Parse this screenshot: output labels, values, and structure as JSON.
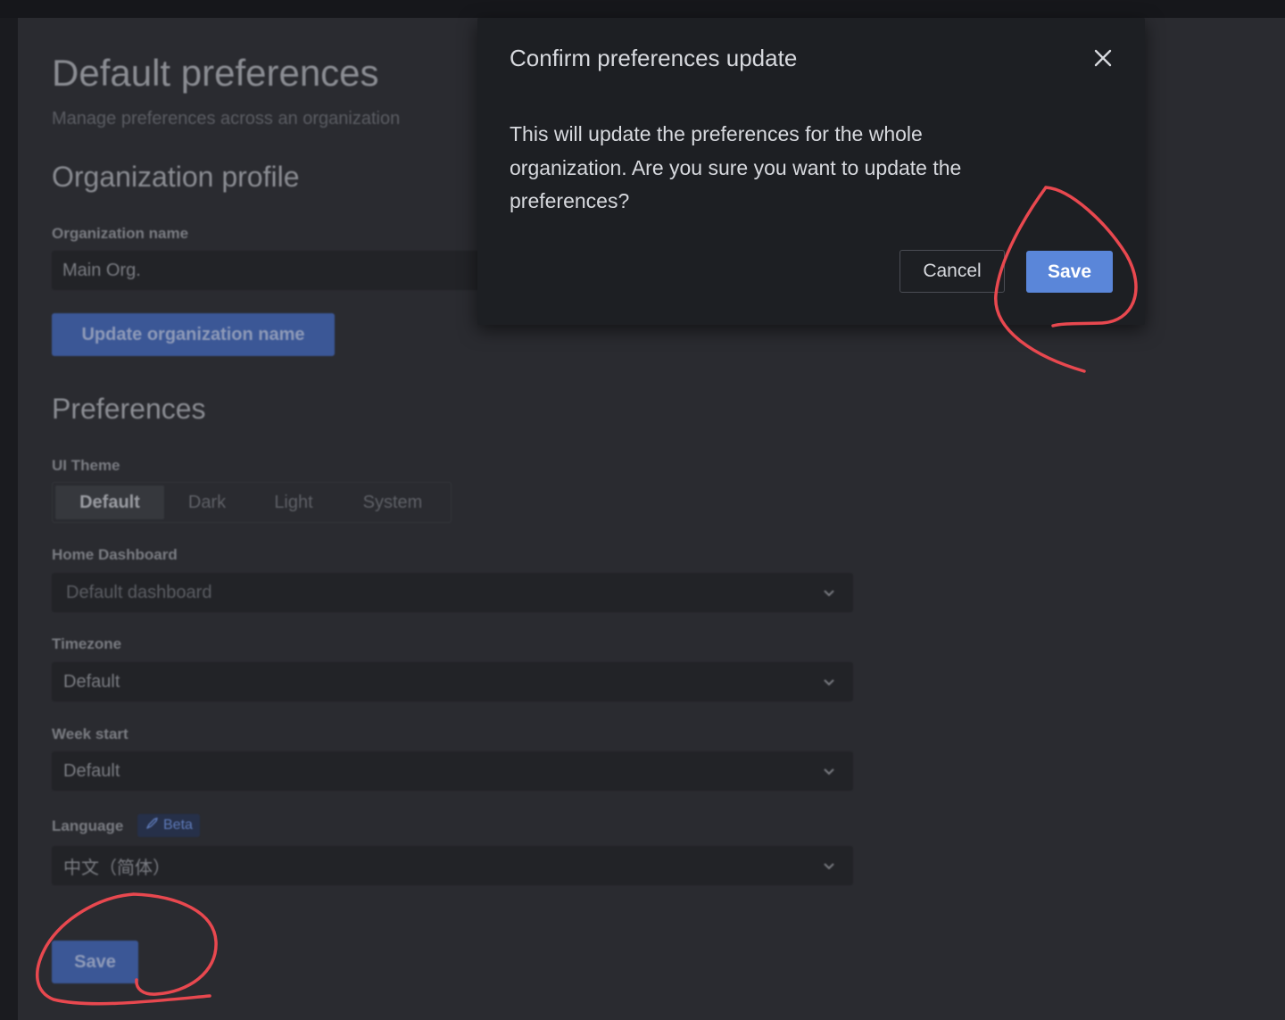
{
  "page": {
    "title": "Default preferences",
    "subtitle": "Manage preferences across an organization"
  },
  "org_profile": {
    "heading": "Organization profile",
    "name_label": "Organization name",
    "name_value": "Main Org.",
    "update_button": "Update organization name"
  },
  "preferences": {
    "heading": "Preferences",
    "theme_label": "UI Theme",
    "theme_options": [
      "Default",
      "Dark",
      "Light",
      "System"
    ],
    "theme_selected": "Default",
    "home_dashboard_label": "Home Dashboard",
    "home_dashboard_placeholder": "Default dashboard",
    "timezone_label": "Timezone",
    "timezone_value": "Default",
    "week_start_label": "Week start",
    "week_start_value": "Default",
    "language_label": "Language",
    "language_badge": "Beta",
    "language_value": "中文（简体）",
    "save_button": "Save"
  },
  "modal": {
    "title": "Confirm preferences update",
    "body": "This will update the preferences for the whole organization. Are you sure you want to update the preferences?",
    "cancel_label": "Cancel",
    "save_label": "Save"
  },
  "colors": {
    "modal_bg": "#1d1f23",
    "primary": "#5a86d9",
    "annotation": "#e8484f"
  },
  "icons": [
    "close-icon",
    "chevron-down-icon",
    "rocket-icon"
  ]
}
